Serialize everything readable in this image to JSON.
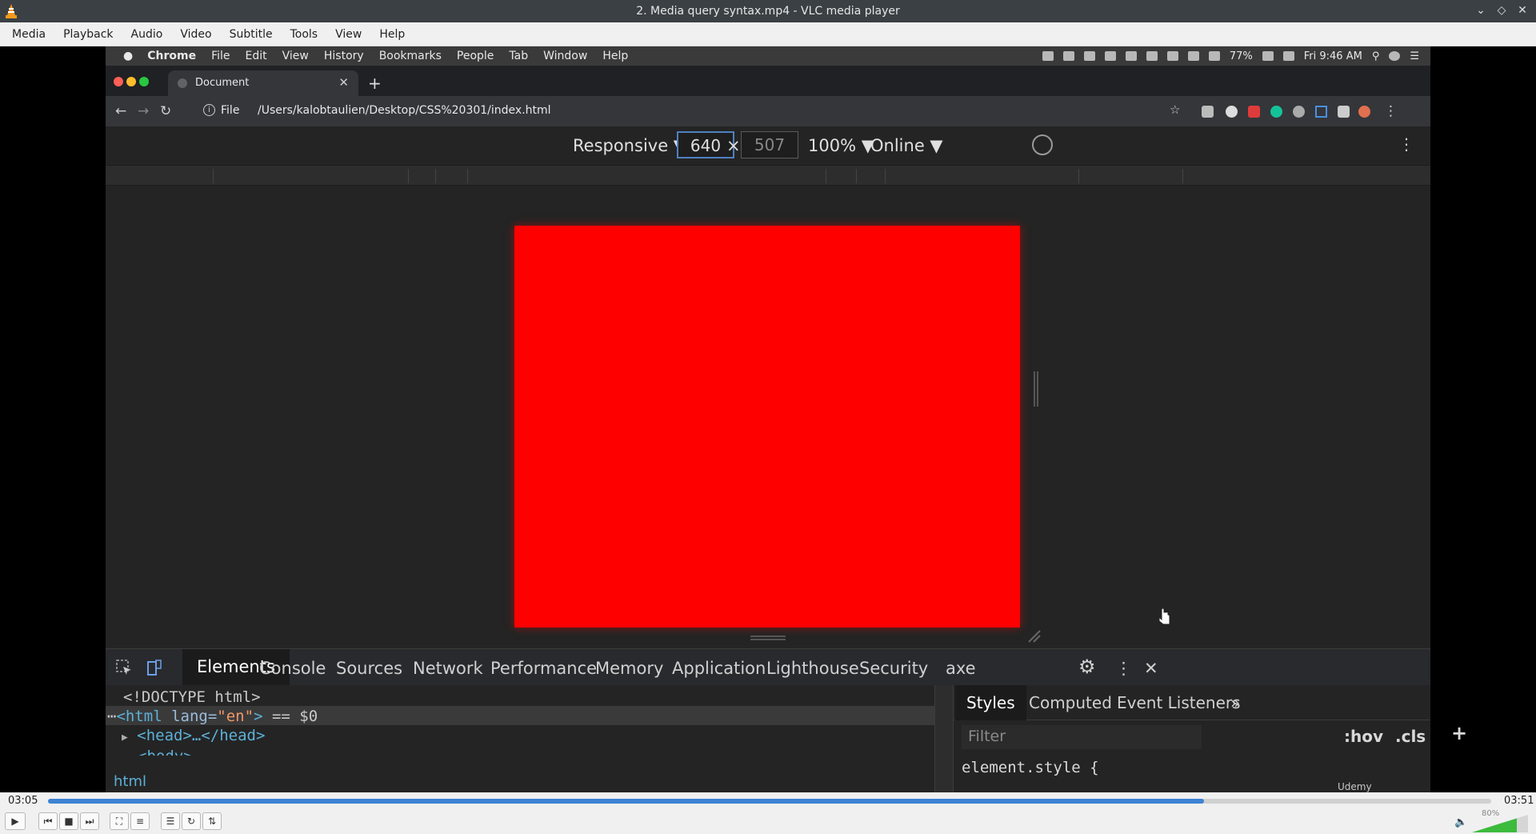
{
  "vlc": {
    "title": "2. Media query syntax.mp4 - VLC media player",
    "menu": [
      "Media",
      "Playback",
      "Audio",
      "Video",
      "Subtitle",
      "Tools",
      "View",
      "Help"
    ],
    "time_elapsed": "03:05",
    "time_total": "03:51",
    "progress_fraction": 0.801,
    "volume_label": "80%",
    "volume_fraction": 0.8
  },
  "mac": {
    "apple": "",
    "menus": [
      "Chrome",
      "File",
      "Edit",
      "View",
      "History",
      "Bookmarks",
      "People",
      "Tab",
      "Window",
      "Help"
    ],
    "battery": "77%",
    "clock": "Fri 9:46 AM"
  },
  "chrome": {
    "tab_title": "Document",
    "scheme_label": "File",
    "url": "/Users/kalobtaulien/Desktop/CSS%20301/index.html"
  },
  "device_toolbar": {
    "device": "Responsive ▼",
    "width": "640",
    "times": "×",
    "height": "507",
    "zoom": "100% ▼",
    "network": "Online ▼"
  },
  "page": {
    "box_color": "#ff0000"
  },
  "devtools": {
    "tabs": [
      "Elements",
      "Console",
      "Sources",
      "Network",
      "Performance",
      "Memory",
      "Application",
      "Lighthouse",
      "Security",
      "axe"
    ],
    "selected_tab": "Elements",
    "dom": {
      "doctype": "<!DOCTYPE html>",
      "html_open_prefix": "⋯",
      "html_tag_open": "<html ",
      "html_attr": "lang=",
      "html_val": "\"en\"",
      "html_tag_close": ">",
      "html_marker": " == $0",
      "head_arrow": "▶",
      "head": "<head>…</head>",
      "body_partial": "<body>"
    },
    "breadcrumb": "html",
    "styles_tabs": [
      "Styles",
      "Computed",
      "Event Listeners",
      "»"
    ],
    "filter_placeholder": "Filter",
    "hov": ":hov",
    "cls": ".cls",
    "plus": "+",
    "element_style": "element.style {",
    "element_style_close": "}",
    "watermark": "Udemy"
  }
}
